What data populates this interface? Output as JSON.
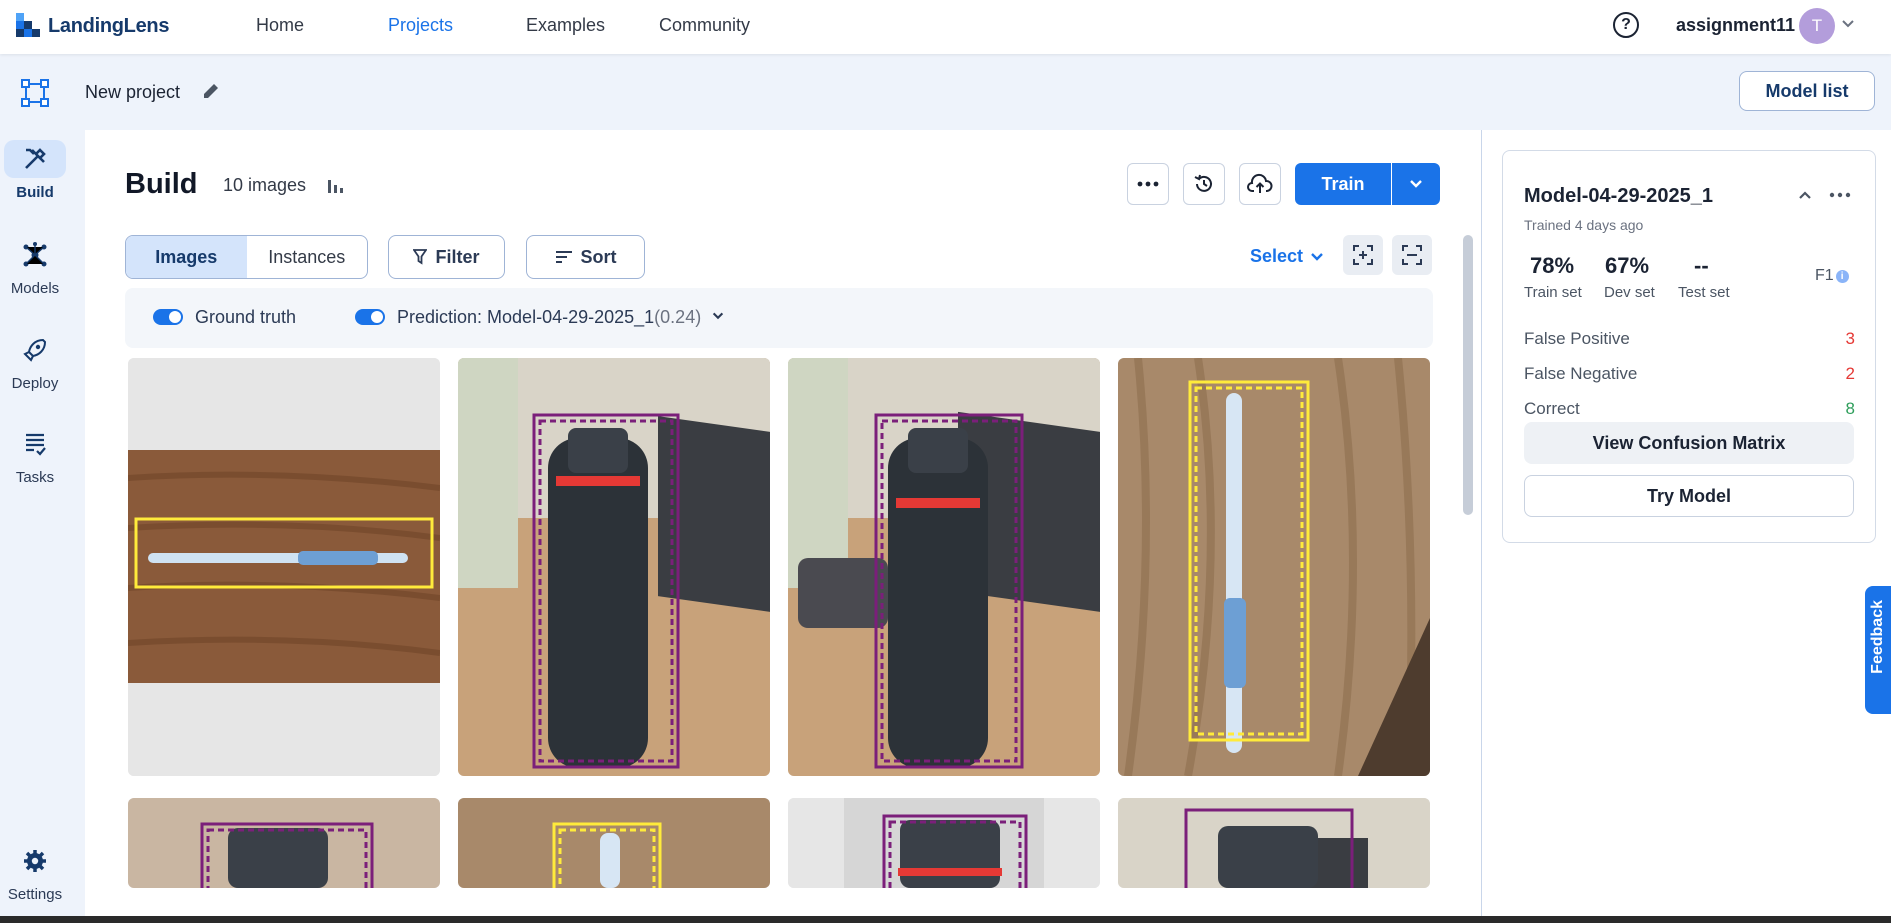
{
  "brand": {
    "name": "LandingLens"
  },
  "nav": {
    "links": [
      {
        "label": "Home"
      },
      {
        "label": "Projects"
      },
      {
        "label": "Examples"
      },
      {
        "label": "Community"
      }
    ],
    "active": "Projects",
    "user": {
      "name": "assignment11",
      "initial": "T"
    }
  },
  "project": {
    "name": "New project",
    "model_list_label": "Model list"
  },
  "sidebar": {
    "items": [
      {
        "label": "Build",
        "icon": "tools-icon"
      },
      {
        "label": "Models",
        "icon": "network-icon"
      },
      {
        "label": "Deploy",
        "icon": "rocket-icon"
      },
      {
        "label": "Tasks",
        "icon": "task-list-icon"
      }
    ],
    "settings_label": "Settings"
  },
  "build": {
    "title": "Build",
    "image_count": "10 images",
    "train_label": "Train",
    "tabs": [
      {
        "label": "Images"
      },
      {
        "label": "Instances"
      }
    ],
    "filter_label": "Filter",
    "sort_label": "Sort",
    "select_label": "Select",
    "ground_truth_label": "Ground truth",
    "prediction_label": "Prediction: Model-04-29-2025_1",
    "prediction_threshold": "(0.24)"
  },
  "images": [
    {
      "label": "pen",
      "box_color": "#ffeb3b"
    },
    {
      "label": "bottle",
      "box_color": "#7b1f7a"
    },
    {
      "label": "bottle",
      "box_color": "#7b1f7a"
    },
    {
      "label": "pen",
      "box_color": "#ffeb3b"
    },
    {
      "label": "bottle",
      "box_color": "#7b1f7a"
    },
    {
      "label": "pen",
      "box_color": "#ffeb3b"
    },
    {
      "label": "bottle",
      "box_color": "#7b1f7a"
    },
    {
      "label": "bottle",
      "box_color": "#7b1f7a"
    }
  ],
  "model": {
    "name": "Model-04-29-2025_1",
    "trained": "Trained 4 days ago",
    "metrics": [
      {
        "value": "78%",
        "label": "Train set"
      },
      {
        "value": "67%",
        "label": "Dev set"
      },
      {
        "value": "--",
        "label": "Test set"
      }
    ],
    "f1_label": "F1",
    "stats": [
      {
        "label": "False Positive",
        "value": "3",
        "color": "#e53935"
      },
      {
        "label": "False Negative",
        "value": "2",
        "color": "#e53935"
      },
      {
        "label": "Correct",
        "value": "8",
        "color": "#2e9e5b"
      }
    ],
    "confusion_label": "View Confusion Matrix",
    "try_label": "Try Model"
  },
  "feedback_label": "Feedback",
  "colors": {
    "accent": "#1a73e8",
    "bottle_box": "#7b1f7a",
    "pen_box": "#ffeb3b"
  }
}
